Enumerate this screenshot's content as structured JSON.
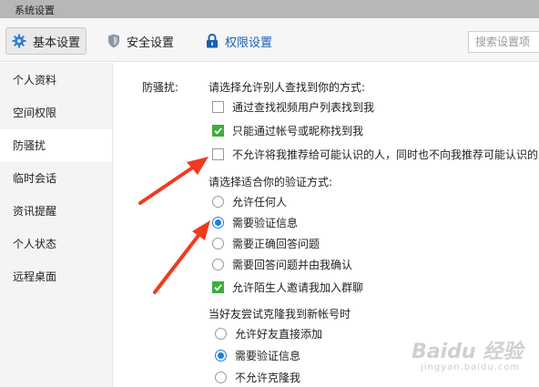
{
  "window": {
    "title": "系统设置"
  },
  "toolbar": {
    "tabs": [
      {
        "label": "基本设置",
        "icon": "gear-icon",
        "icon_color": "#2f7fd6",
        "selected": true
      },
      {
        "label": "安全设置",
        "icon": "shield-icon",
        "icon_color": "#8a97a8"
      },
      {
        "label": "权限设置",
        "icon": "lock-icon",
        "icon_color": "#1a5fb4"
      }
    ],
    "search_placeholder": "搜索设置项"
  },
  "sidebar": {
    "items": [
      {
        "label": "个人资料"
      },
      {
        "label": "空间权限"
      },
      {
        "label": "防骚扰",
        "selected": true
      },
      {
        "label": "临时会话"
      },
      {
        "label": "资讯提醒"
      },
      {
        "label": "个人状态"
      },
      {
        "label": "远程桌面"
      }
    ]
  },
  "main": {
    "section_label": "防骚扰:",
    "find_prompt": "请选择允许别人查找到你的方式:",
    "find_options": [
      {
        "label": "通过查找视频用户列表找到我",
        "checked": false
      },
      {
        "label": "只能通过帐号或昵称找到我",
        "checked": true
      },
      {
        "label": "不允许将我推荐给可能认识的人，同时也不向我推荐可能认识的人",
        "checked": false
      }
    ],
    "verify_prompt": "请选择适合你的验证方式:",
    "verify_options": [
      {
        "label": "允许任何人",
        "selected": false
      },
      {
        "label": "需要验证信息",
        "selected": true
      },
      {
        "label": "需要正确回答问题",
        "selected": false
      },
      {
        "label": "需要回答问题并由我确认",
        "selected": false
      }
    ],
    "group_invite": {
      "label": "允许陌生人邀请我加入群聊",
      "checked": true
    },
    "clone_prompt": "当好友尝试克隆我到新帐号时",
    "clone_options": [
      {
        "label": "允许好友直接添加",
        "selected": false
      },
      {
        "label": "需要验证信息",
        "selected": true
      },
      {
        "label": "不允许克隆我",
        "selected": false
      }
    ]
  },
  "annotation": {
    "arrow_color": "#f03b20"
  },
  "watermark": {
    "text": "Baidu 经验",
    "sub": "jingyan.baidu.com"
  },
  "colors": {
    "accent": "#1a7ee0",
    "check_green": "#3cae3c"
  }
}
